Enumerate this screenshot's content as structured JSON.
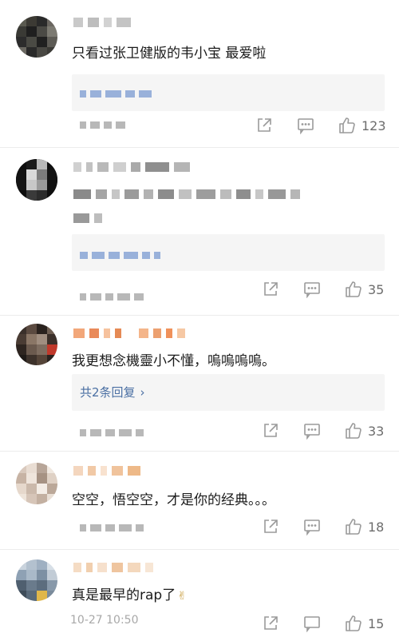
{
  "comments": [
    {
      "text": "只看过张卫健版的韦小宝 最爱啦",
      "likes": "123"
    },
    {
      "text": "",
      "likes": "35"
    },
    {
      "text": "我更想念機靈小不懂，嗚嗚嗚嗚。",
      "reply_link": "共2条回复",
      "likes": "33"
    },
    {
      "text": "空空，悟空空，才是你的经典。。。",
      "likes": "18"
    },
    {
      "text": "真是最早的rap了",
      "time": "10-27 10:50",
      "likes": "15"
    }
  ],
  "icons": {
    "share": "share-icon",
    "comment": "comment-icon",
    "like": "thumbs-up-icon",
    "chevron": "chevron-right-icon"
  },
  "colors": {
    "link": "#4a6fa3",
    "reply_bg": "#f5f5f5",
    "icon_gray": "#9a9a9a"
  }
}
